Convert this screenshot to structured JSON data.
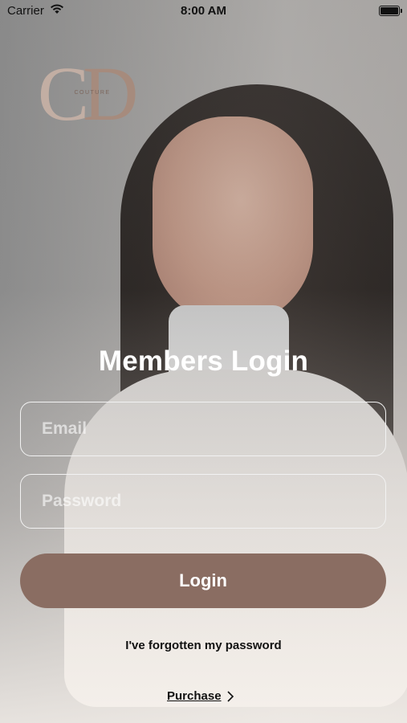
{
  "status_bar": {
    "carrier": "Carrier",
    "time": "8:00 AM"
  },
  "logo": {
    "letters": "CD",
    "tagline": "COUTURE"
  },
  "login": {
    "title": "Members Login",
    "email_placeholder": "Email",
    "password_placeholder": "Password",
    "button_label": "Login",
    "forgot_link": "I've forgotten my password",
    "purchase_link": "Purchase"
  },
  "colors": {
    "button": "#8a6d62",
    "logo": "#b59a8c"
  }
}
